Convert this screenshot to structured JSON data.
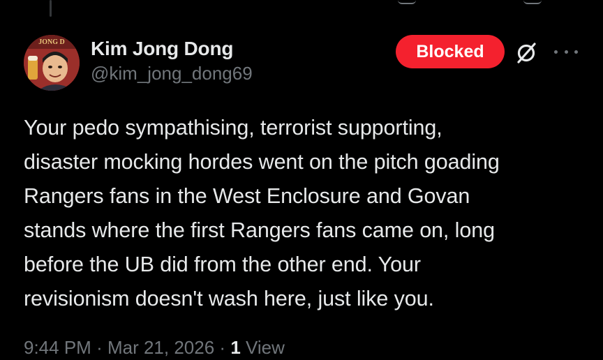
{
  "author": {
    "display_name": "Kim Jong Dong",
    "handle": "@kim_jong_dong69",
    "avatar_banner_text": "JONG D"
  },
  "actions": {
    "blocked_label": "Blocked",
    "grok_icon": "slashed-circle-icon",
    "more_icon": "more-dots-icon"
  },
  "tweet": {
    "lines": [
      "Your pedo sympathising, terrorist supporting,",
      "disaster mocking hordes went on the pitch goading",
      "Rangers fans in the West Enclosure and Govan",
      "stands where the first Rangers fans came on, long",
      "before the UB did from the other end. Your",
      "revisionism doesn't wash here, just like you."
    ]
  },
  "meta": {
    "time": "9:44 PM",
    "separator": "·",
    "date": "Mar 21, 2026",
    "views_count": "1",
    "views_label": "View"
  },
  "colors": {
    "background": "#000000",
    "primary_text": "#e7e9ea",
    "secondary_text": "#71767b",
    "blocked_red": "#f4212e"
  }
}
